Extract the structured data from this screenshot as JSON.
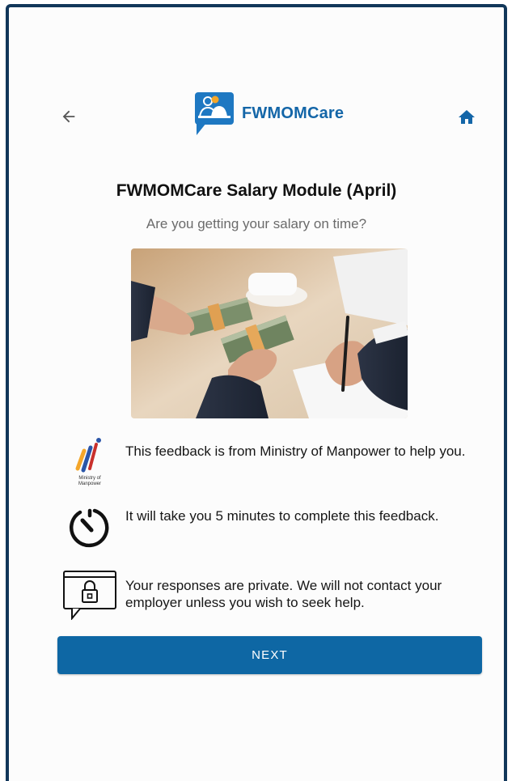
{
  "header": {
    "brand_name": "FWMOMCare",
    "back_icon": "arrow-left-icon",
    "home_icon": "home-icon"
  },
  "content": {
    "title": "FWMOMCare Salary Module (April)",
    "subtitle": "Are you getting your salary on time?",
    "hero_image": "money-exchange-photo"
  },
  "info_items": [
    {
      "icon": "ministry-of-manpower-logo",
      "logo_text": "Ministry of Manpower",
      "text": "This feedback is from Ministry of Manpower to help you."
    },
    {
      "icon": "timer-icon",
      "text": "It will take you 5 minutes to complete this feedback."
    },
    {
      "icon": "private-lock-message-icon",
      "text": "Your responses are private. We will not contact your employer unless you wish to seek help."
    }
  ],
  "actions": {
    "next_label": "NEXT"
  },
  "colors": {
    "accent": "#1466a8",
    "button": "#0e67a4",
    "frame_border": "#12375a"
  }
}
